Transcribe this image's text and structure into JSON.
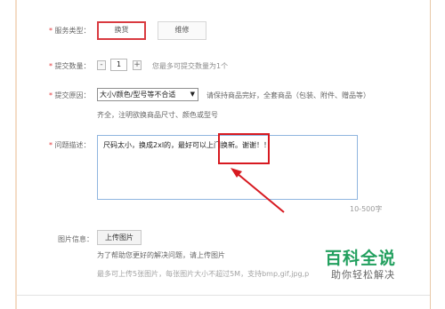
{
  "service_type": {
    "label": "服务类型：",
    "options": [
      "换货",
      "维修"
    ],
    "selected": "换货"
  },
  "quantity": {
    "label": "提交数量：",
    "minus": "-",
    "value": "1",
    "plus": "+",
    "hint": "您最多可提交数量为1个"
  },
  "reason": {
    "label": "提交原因：",
    "selected": "大小/颜色/型号等不合适",
    "hint": "请保持商品完好，全套商品（包装、附件、赠品等）",
    "hint2": "齐全，注明欲换商品尺寸、颜色或型号"
  },
  "description": {
    "label": "问题描述：",
    "text_before": "尺码太小，换成2xl的，",
    "text_highlight": "最好可以上门换新。",
    "text_after": "谢谢！！",
    "counter": "10-500字"
  },
  "images": {
    "label": "图片信息：",
    "upload_label": "上传图片",
    "hint": "为了帮助您更好的解决问题，请上传图片",
    "limits": "最多可上传5张图片，每张图片大小不超过5M，支持bmp,gif,jpg,p"
  },
  "watermark": {
    "title": "百科全说",
    "subtitle": "助你轻松解决"
  },
  "colors": {
    "required": "#e4393c",
    "annotation": "#d71920",
    "watermark": "#23a05f"
  }
}
